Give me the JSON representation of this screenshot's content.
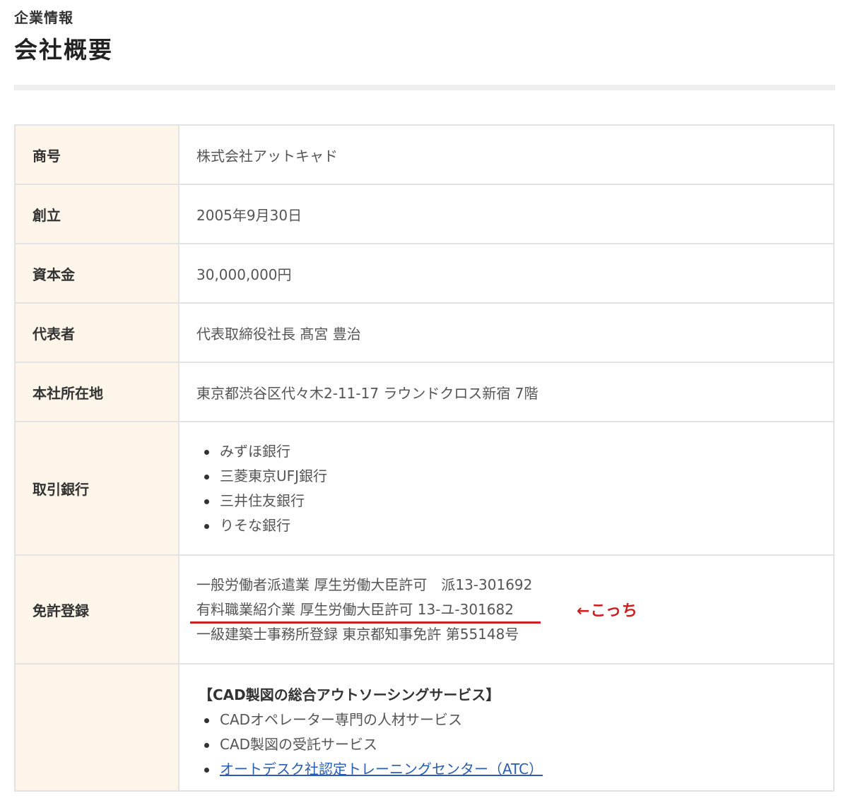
{
  "header": {
    "category": "企業情報",
    "title": "会社概要"
  },
  "table": {
    "name": {
      "label": "商号",
      "value": "株式会社アットキャド"
    },
    "founded": {
      "label": "創立",
      "value": "2005年9月30日"
    },
    "capital": {
      "label": "資本金",
      "value": "30,000,000円"
    },
    "representative": {
      "label": "代表者",
      "value": "代表取締役社長 髙宮 豊治"
    },
    "address": {
      "label": "本社所在地",
      "value": "東京都渋谷区代々木2-11-17 ラウンドクロス新宿 7階"
    },
    "banks": {
      "label": "取引銀行",
      "items": [
        "みずほ銀行",
        "三菱東京UFJ銀行",
        "三井住友銀行",
        "りそな銀行"
      ]
    },
    "license": {
      "label": "免許登録",
      "lines": [
        "一般労働者派遣業 厚生労働大臣許可　派13-301692",
        "有料職業紹介業 厚生労働大臣許可 13-ユ-301682",
        "一級建築士事務所登録 東京都知事免許 第55148号"
      ],
      "annotation": "←こっち"
    },
    "service": {
      "label": "",
      "heading": "【CAD製図の総合アウトソーシングサービス】",
      "items": [
        "CADオペレーター専門の人材サービス",
        "CAD製図の受託サービス"
      ],
      "link": "オートデスク社認定トレーニングセンター（ATC）"
    }
  },
  "colors": {
    "label_bg": "#fdf5e9",
    "border": "#e3e3e3",
    "highlight": "#cc1f1f",
    "link": "#2a5db0"
  }
}
